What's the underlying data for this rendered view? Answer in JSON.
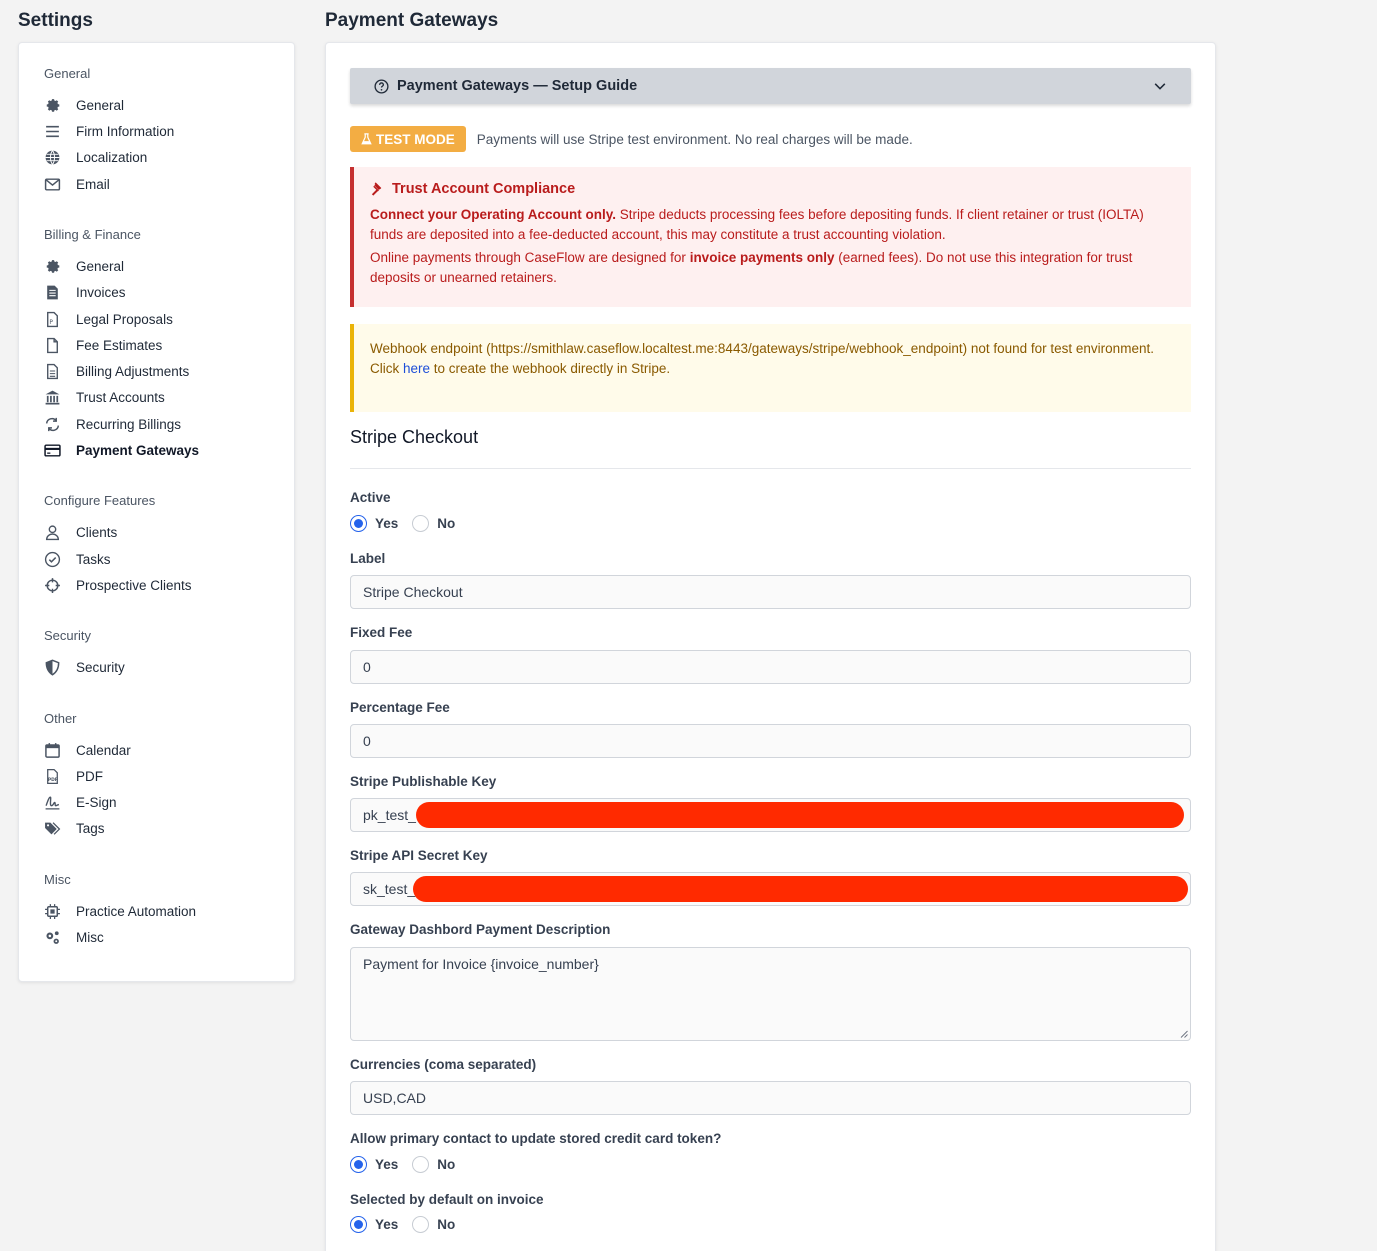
{
  "settings_title": "Settings",
  "main_title": "Payment Gateways",
  "sidebar": {
    "sections": [
      {
        "title": "General",
        "items": [
          {
            "label": "General",
            "icon": "gear-icon"
          },
          {
            "label": "Firm Information",
            "icon": "bars-icon"
          },
          {
            "label": "Localization",
            "icon": "globe-icon"
          },
          {
            "label": "Email",
            "icon": "envelope-icon"
          }
        ]
      },
      {
        "title": "Billing & Finance",
        "items": [
          {
            "label": "General",
            "icon": "gear-icon"
          },
          {
            "label": "Invoices",
            "icon": "invoice-icon"
          },
          {
            "label": "Legal Proposals",
            "icon": "document-icon"
          },
          {
            "label": "Fee Estimates",
            "icon": "file-icon"
          },
          {
            "label": "Billing Adjustments",
            "icon": "document-lines-icon"
          },
          {
            "label": "Trust Accounts",
            "icon": "bank-icon"
          },
          {
            "label": "Recurring Billings",
            "icon": "repeat-icon"
          },
          {
            "label": "Payment Gateways",
            "icon": "credit-card-icon"
          }
        ]
      },
      {
        "title": "Configure Features",
        "items": [
          {
            "label": "Clients",
            "icon": "user-icon"
          },
          {
            "label": "Tasks",
            "icon": "check-circle-icon"
          },
          {
            "label": "Prospective Clients",
            "icon": "crosshair-icon"
          }
        ]
      },
      {
        "title": "Security",
        "items": [
          {
            "label": "Security",
            "icon": "shield-icon"
          }
        ]
      },
      {
        "title": "Other",
        "items": [
          {
            "label": "Calendar",
            "icon": "calendar-icon"
          },
          {
            "label": "PDF",
            "icon": "pdf-icon"
          },
          {
            "label": "E-Sign",
            "icon": "signature-icon"
          },
          {
            "label": "Tags",
            "icon": "tags-icon"
          }
        ]
      },
      {
        "title": "Misc",
        "items": [
          {
            "label": "Practice Automation",
            "icon": "chip-icon"
          },
          {
            "label": "Misc",
            "icon": "gears-icon"
          }
        ]
      }
    ]
  },
  "guide": {
    "title": "Payment Gateways — Setup Guide"
  },
  "test_mode": {
    "badge": "TEST MODE",
    "text": "Payments will use Stripe test environment. No real charges will be made."
  },
  "trust_alert": {
    "title": "Trust Account Compliance",
    "p1_bold": "Connect your Operating Account only.",
    "p1_rest": " Stripe deducts processing fees before depositing funds. If client retainer or trust (IOLTA) funds are deposited into a fee-deducted account, this may constitute a trust accounting violation.",
    "p2_start": "Online payments through CaseFlow are designed for ",
    "p2_bold": "invoice payments only",
    "p2_end": " (earned fees). Do not use this integration for trust deposits or unearned retainers."
  },
  "webhook_alert": {
    "line1": "Webhook endpoint (https://smithlaw.caseflow.localtest.me:8443/gateways/stripe/webhook_endpoint) not found for test environment.",
    "click": "Click ",
    "link": "here",
    "rest": " to create the webhook directly in Stripe."
  },
  "form": {
    "heading": "Stripe Checkout",
    "active": {
      "label": "Active",
      "yes": "Yes",
      "no": "No",
      "selected": "yes"
    },
    "label_field": {
      "label": "Label",
      "value": "Stripe Checkout"
    },
    "fixed_fee": {
      "label": "Fixed Fee",
      "value": "0"
    },
    "percentage_fee": {
      "label": "Percentage Fee",
      "value": "0"
    },
    "publishable_key": {
      "label": "Stripe Publishable Key",
      "value": "pk_test_"
    },
    "secret_key": {
      "label": "Stripe API Secret Key",
      "value": "sk_test_"
    },
    "description": {
      "label": "Gateway Dashbord Payment Description",
      "value": "Payment for Invoice {invoice_number}"
    },
    "currencies": {
      "label": "Currencies (coma separated)",
      "value": "USD,CAD"
    },
    "allow_update": {
      "label": "Allow primary contact to update stored credit card token?",
      "yes": "Yes",
      "no": "No",
      "selected": "yes"
    },
    "default_selected": {
      "label": "Selected by default on invoice",
      "yes": "Yes",
      "no": "No",
      "selected": "yes"
    }
  },
  "colors": {
    "accent": "#2563eb",
    "test_badge": "#f3ad43",
    "danger": "#b91c1c",
    "warning_border": "#eab308",
    "redaction": "#ff2a00"
  }
}
